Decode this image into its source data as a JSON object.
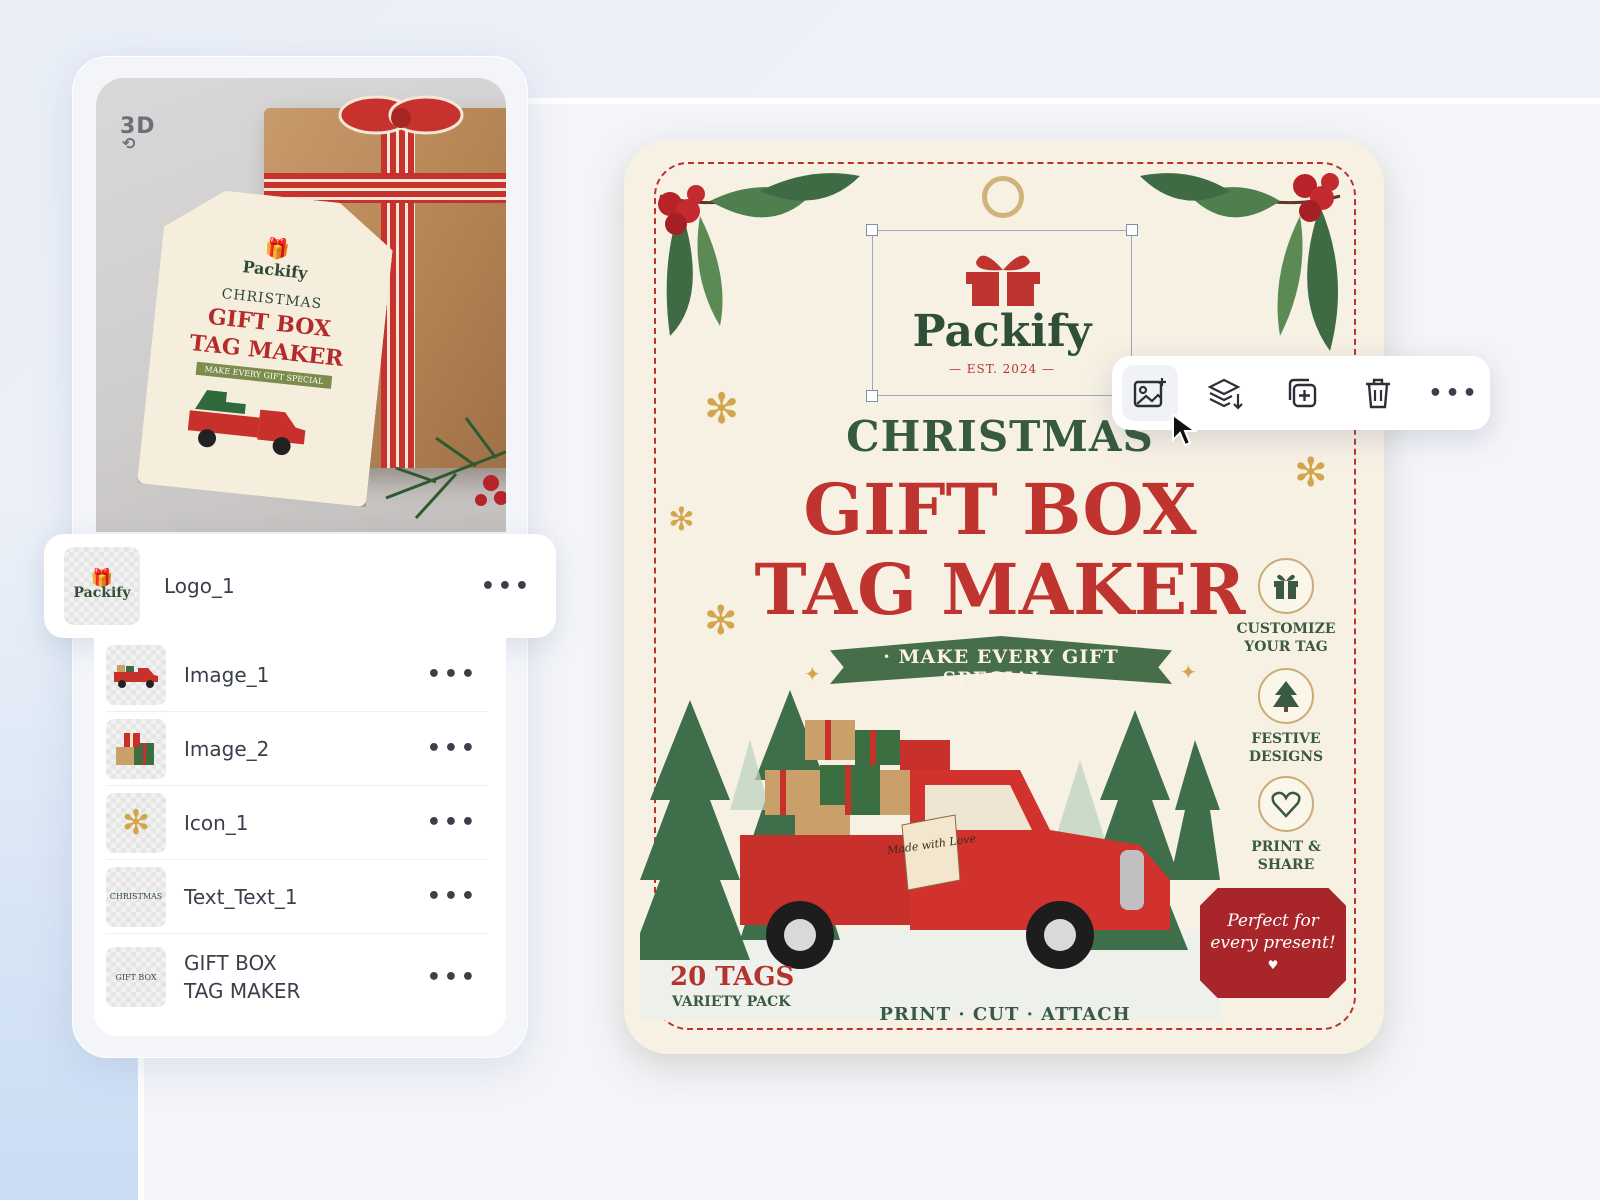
{
  "preview": {
    "badge_label": "3D",
    "mini_tag": {
      "brand": "Packify",
      "line1": "CHRISTMAS",
      "line2": "GIFT BOX",
      "line3": "TAG MAKER",
      "ribbon": "MAKE EVERY GIFT SPECIAL"
    }
  },
  "layers": {
    "selected": {
      "name": "Logo_1",
      "thumb_text": "Packify"
    },
    "items": [
      {
        "name": "Image_1",
        "thumb_icon": "truck-icon"
      },
      {
        "name": "Image_2",
        "thumb_icon": "gifts-icon"
      },
      {
        "name": "Icon_1",
        "thumb_icon": "snowflake-icon"
      },
      {
        "name": "Text_Text_1",
        "thumb_text": "CHRISTMAS"
      },
      {
        "name": "GIFT BOX\nTAG MAKER",
        "thumb_text": "GIFT BOX"
      }
    ],
    "more_label": "•••"
  },
  "tag": {
    "brand_name": "Packify",
    "brand_est": "— EST. 2024 —",
    "title_small": "CHRISTMAS",
    "title_line1": "GIFT BOX",
    "title_line2": "TAG MAKER",
    "banner": "· MAKE EVERY GIFT SPECIAL ·",
    "features": [
      {
        "label": "CUSTOMIZE YOUR TAG",
        "icon": "gift-icon"
      },
      {
        "label": "FESTIVE DESIGNS",
        "icon": "tree-icon"
      },
      {
        "label": "PRINT & SHARE",
        "icon": "heart-icon"
      }
    ],
    "badge_line1": "Perfect for",
    "badge_line2": "every present!",
    "count": "20 TAGS",
    "count_sub": "VARIETY PACK",
    "footer": "PRINT · CUT · ATTACH",
    "truck_tag_text": "Made with Love"
  },
  "toolbar": {
    "items": [
      "replace-image-icon",
      "layers-icon",
      "duplicate-icon",
      "delete-icon",
      "more-icon"
    ]
  },
  "colors": {
    "red": "#c0342f",
    "green": "#355a3d",
    "cream": "#f7f1e4",
    "gold": "#c9ad76"
  }
}
